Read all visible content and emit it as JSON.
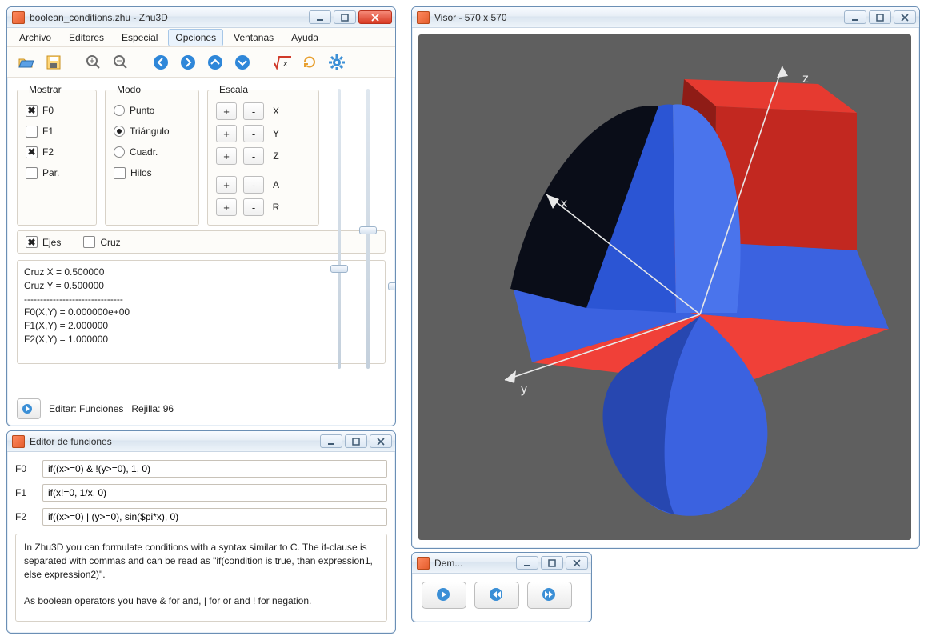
{
  "main": {
    "title": "boolean_conditions.zhu - Zhu3D",
    "menu": [
      "Archivo",
      "Editores",
      "Especial",
      "Opciones",
      "Ventanas",
      "Ayuda"
    ],
    "menu_active_index": 3,
    "groups": {
      "mostrar": {
        "legend": "Mostrar",
        "items": [
          {
            "label": "F0",
            "checked": true
          },
          {
            "label": "F1",
            "checked": false
          },
          {
            "label": "F2",
            "checked": true
          },
          {
            "label": "Par.",
            "checked": false
          }
        ]
      },
      "modo": {
        "legend": "Modo",
        "radios": [
          {
            "label": "Punto",
            "selected": false
          },
          {
            "label": "Triángulo",
            "selected": true
          },
          {
            "label": "Cuadr.",
            "selected": false
          }
        ],
        "hilos": {
          "label": "Hilos",
          "checked": false
        }
      },
      "escala": {
        "legend": "Escala",
        "axes": [
          "X",
          "Y",
          "Z",
          "A",
          "R"
        ]
      }
    },
    "row2": {
      "ejes": {
        "label": "Ejes",
        "checked": true
      },
      "cruz": {
        "label": "Cruz",
        "checked": false
      }
    },
    "output_text": "Cruz X = 0.500000\nCruz Y = 0.500000\n-------------------------------\nF0(X,Y) = 0.000000e+00\nF1(X,Y) = 2.000000\nF2(X,Y) = 1.000000",
    "status": {
      "editar": "Editar: Funciones",
      "rejilla": "Rejilla: 96"
    },
    "scale_btn_plus": "+",
    "scale_btn_minus": "-"
  },
  "editor": {
    "title": "Editor de funciones",
    "rows": [
      {
        "label": "F0",
        "value": "if((x>=0) & !(y>=0), 1, 0)"
      },
      {
        "label": "F1",
        "value": "if(x!=0, 1/x, 0)"
      },
      {
        "label": "F2",
        "value": "if((x>=0) | (y>=0), sin($pi*x), 0)"
      }
    ],
    "help": "In Zhu3D you can formulate conditions with a syntax similar to C. The if-clause is separated with commas and can be read as \"if(condition is true, than expression1, else expression2)\".\n\nAs boolean operators you have & for and, | for or and ! for negation."
  },
  "visor": {
    "title": "Visor - 570 x 570",
    "axis_labels": {
      "x": "x",
      "y": "y",
      "z": "z"
    }
  },
  "demo": {
    "title": "Dem..."
  }
}
